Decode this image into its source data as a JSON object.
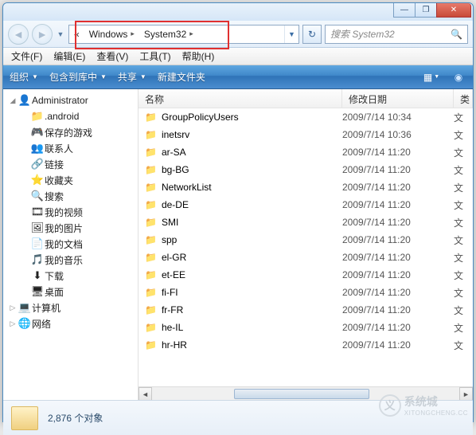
{
  "window_controls": {
    "min": "—",
    "max": "❐",
    "close": "✕"
  },
  "breadcrumbs": {
    "overflow": "«",
    "items": [
      "Windows",
      "System32"
    ]
  },
  "search": {
    "placeholder": "搜索 System32"
  },
  "menubar": [
    {
      "label": "文件(F)"
    },
    {
      "label": "编辑(E)"
    },
    {
      "label": "查看(V)"
    },
    {
      "label": "工具(T)"
    },
    {
      "label": "帮助(H)"
    }
  ],
  "toolbar": {
    "organize": "组织",
    "include": "包含到库中",
    "share": "共享",
    "newfolder": "新建文件夹"
  },
  "tree": [
    {
      "label": "Administrator",
      "icon": "user",
      "expander": "◢",
      "indent": 0
    },
    {
      "label": ".android",
      "icon": "folder",
      "expander": "",
      "indent": 1
    },
    {
      "label": "保存的游戏",
      "icon": "savedgames",
      "expander": "",
      "indent": 1
    },
    {
      "label": "联系人",
      "icon": "contacts",
      "expander": "",
      "indent": 1
    },
    {
      "label": "链接",
      "icon": "links",
      "expander": "",
      "indent": 1
    },
    {
      "label": "收藏夹",
      "icon": "favorites",
      "expander": "",
      "indent": 1
    },
    {
      "label": "搜索",
      "icon": "search",
      "expander": "",
      "indent": 1
    },
    {
      "label": "我的视频",
      "icon": "videos",
      "expander": "",
      "indent": 1
    },
    {
      "label": "我的图片",
      "icon": "pictures",
      "expander": "",
      "indent": 1
    },
    {
      "label": "我的文档",
      "icon": "documents",
      "expander": "",
      "indent": 1
    },
    {
      "label": "我的音乐",
      "icon": "music",
      "expander": "",
      "indent": 1
    },
    {
      "label": "下载",
      "icon": "downloads",
      "expander": "",
      "indent": 1
    },
    {
      "label": "桌面",
      "icon": "desktop",
      "expander": "",
      "indent": 1
    },
    {
      "label": "计算机",
      "icon": "computer",
      "expander": "▷",
      "indent": 0
    },
    {
      "label": "网络",
      "icon": "network",
      "expander": "▷",
      "indent": 0
    }
  ],
  "columns": {
    "name": "名称",
    "date": "修改日期",
    "type": "类"
  },
  "rows": [
    {
      "name": "GroupPolicyUsers",
      "date": "2009/7/14 10:34",
      "type": "文"
    },
    {
      "name": "inetsrv",
      "date": "2009/7/14 10:36",
      "type": "文"
    },
    {
      "name": "ar-SA",
      "date": "2009/7/14 11:20",
      "type": "文"
    },
    {
      "name": "bg-BG",
      "date": "2009/7/14 11:20",
      "type": "文"
    },
    {
      "name": "NetworkList",
      "date": "2009/7/14 11:20",
      "type": "文"
    },
    {
      "name": "de-DE",
      "date": "2009/7/14 11:20",
      "type": "文"
    },
    {
      "name": "SMI",
      "date": "2009/7/14 11:20",
      "type": "文"
    },
    {
      "name": "spp",
      "date": "2009/7/14 11:20",
      "type": "文"
    },
    {
      "name": "el-GR",
      "date": "2009/7/14 11:20",
      "type": "文"
    },
    {
      "name": "et-EE",
      "date": "2009/7/14 11:20",
      "type": "文"
    },
    {
      "name": "fi-FI",
      "date": "2009/7/14 11:20",
      "type": "文"
    },
    {
      "name": "fr-FR",
      "date": "2009/7/14 11:20",
      "type": "文"
    },
    {
      "name": "he-IL",
      "date": "2009/7/14 11:20",
      "type": "文"
    },
    {
      "name": "hr-HR",
      "date": "2009/7/14 11:20",
      "type": "文"
    }
  ],
  "status": {
    "count": "2,876 个对象"
  },
  "watermark": {
    "brand": "系统城",
    "sub": "XITONGCHENG.CC",
    "logo": "义"
  }
}
